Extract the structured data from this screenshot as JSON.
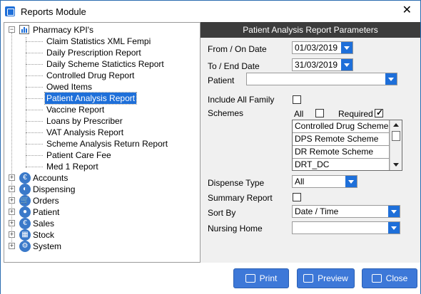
{
  "window": {
    "title": "Reports Module",
    "close_glyph": "✕"
  },
  "tree": {
    "root": {
      "label": "Pharmacy KPI's",
      "expander": "−",
      "icon": "chart-icon"
    },
    "reports": [
      "Claim Statistics XML Fempi",
      "Daily Prescription Report",
      "Daily Scheme Statictics Report",
      "Controlled Drug Report",
      "Owed Items",
      "Patient Analysis Report",
      "Vaccine Report",
      "Loans by Prescriber",
      "VAT Analysis Report",
      "Scheme Analysis Return Report",
      "Patient Care Fee",
      "Med 1 Report"
    ],
    "selected_index": 5,
    "categories": [
      {
        "label": "Accounts",
        "icon": "euro-icon",
        "glyph": "€"
      },
      {
        "label": "Dispensing",
        "icon": "pill-icon",
        "glyph": "◐"
      },
      {
        "label": "Orders",
        "icon": "cart-icon",
        "glyph": "🛒"
      },
      {
        "label": "Patient",
        "icon": "person-icon",
        "glyph": "●"
      },
      {
        "label": "Sales",
        "icon": "euro-icon",
        "glyph": "€"
      },
      {
        "label": "Stock",
        "icon": "boxes-icon",
        "glyph": "▦"
      },
      {
        "label": "System",
        "icon": "gear-icon",
        "glyph": "⚙"
      }
    ],
    "category_expander": "+"
  },
  "panel": {
    "header": "Patient Analysis Report Parameters",
    "from_label": "From / On Date",
    "from_value": "01/03/2019",
    "to_label": "To / End Date",
    "to_value": "31/03/2019",
    "patient_label": "Patient",
    "patient_value": "",
    "include_family_label": "Include All Family",
    "include_family_checked": false,
    "schemes_label": "Schemes",
    "all_label": "All",
    "all_checked": false,
    "required_label": "Required",
    "required_checked": true,
    "schemes": [
      "Controlled Drug Scheme",
      "DPS Remote Scheme",
      "DR Remote Scheme",
      "DRT_DC"
    ],
    "dispense_type_label": "Dispense Type",
    "dispense_type_value": "All",
    "summary_label": "Summary Report",
    "summary_checked": false,
    "sort_by_label": "Sort By",
    "sort_by_value": "Date / Time",
    "nursing_home_label": "Nursing Home",
    "nursing_home_value": ""
  },
  "buttons": {
    "print_label": "Print",
    "preview_label": "Preview",
    "close_label": "Close",
    "print_icon": "printer-icon",
    "preview_icon": "preview-icon",
    "close_icon": "exit-icon",
    "color": "#3d78d8"
  },
  "colors": {
    "selection": "#1e6fd9",
    "header_bg": "#3c3c3c"
  }
}
